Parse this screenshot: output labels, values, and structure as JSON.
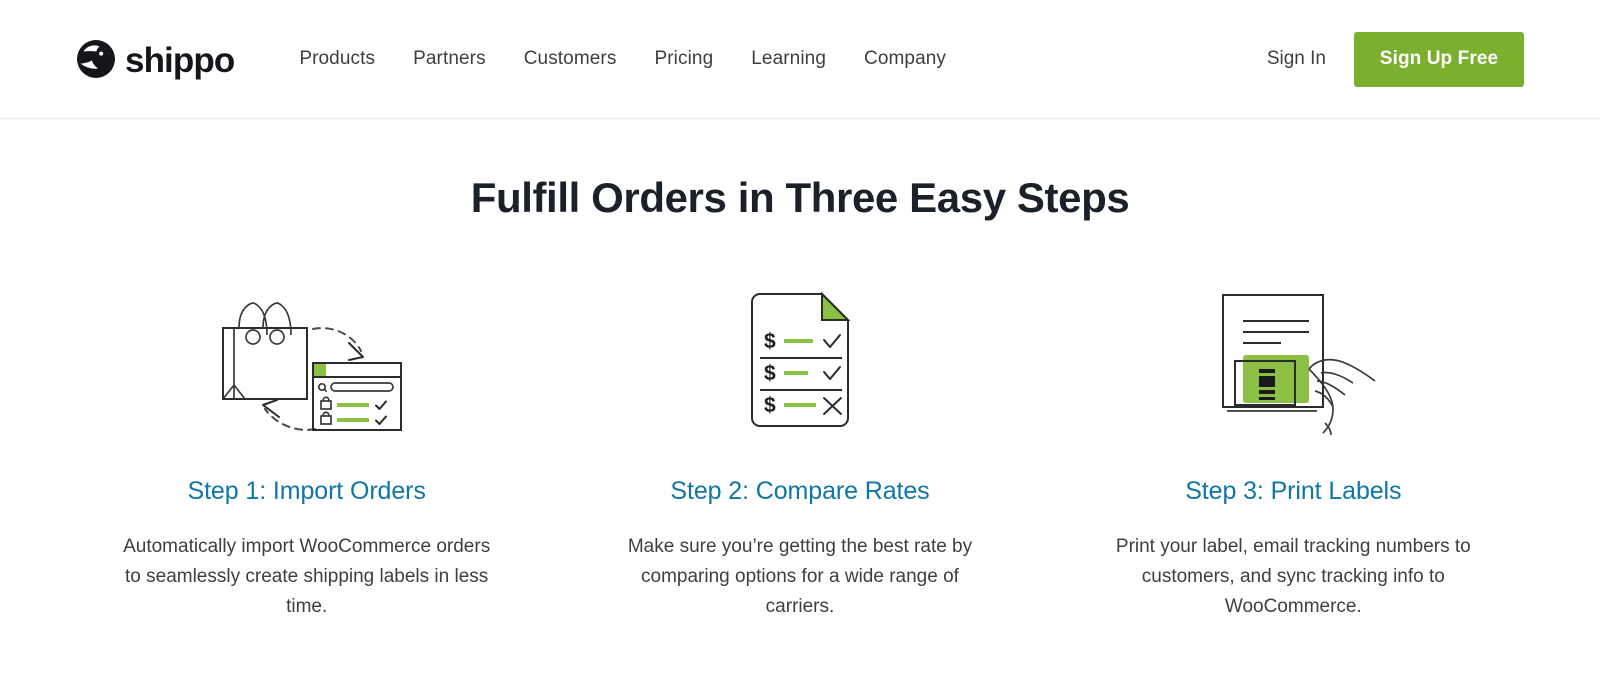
{
  "header": {
    "brand": {
      "name": "shippo",
      "logo_icon": "shippo-cat-logo-icon"
    },
    "nav": [
      {
        "label": "Products"
      },
      {
        "label": "Partners"
      },
      {
        "label": "Customers"
      },
      {
        "label": "Pricing"
      },
      {
        "label": "Learning"
      },
      {
        "label": "Company"
      }
    ],
    "actions": {
      "signin_label": "Sign In",
      "signup_label": "Sign Up Free",
      "signup_color": "#7ab02e"
    }
  },
  "main": {
    "title": "Fulfill Orders in Three Easy Steps",
    "title_color": "#1b2029",
    "step_title_color": "#0f76a8",
    "accent_green": "#8cc044",
    "steps": [
      {
        "icon": "shopping-bag-to-store-icon",
        "title": "Step 1: Import Orders",
        "description": "Automatically import WooCommerce orders to seamlessly create shipping labels in less time."
      },
      {
        "icon": "rate-comparison-document-icon",
        "title": "Step 2: Compare Rates",
        "description": "Make sure you’re getting the best rate by comparing options for a wide range of carriers."
      },
      {
        "icon": "print-shipping-label-hand-icon",
        "title": "Step 3: Print Labels",
        "description": "Print your label, email tracking numbers to customers, and sync tracking info to WooCommerce."
      }
    ]
  }
}
